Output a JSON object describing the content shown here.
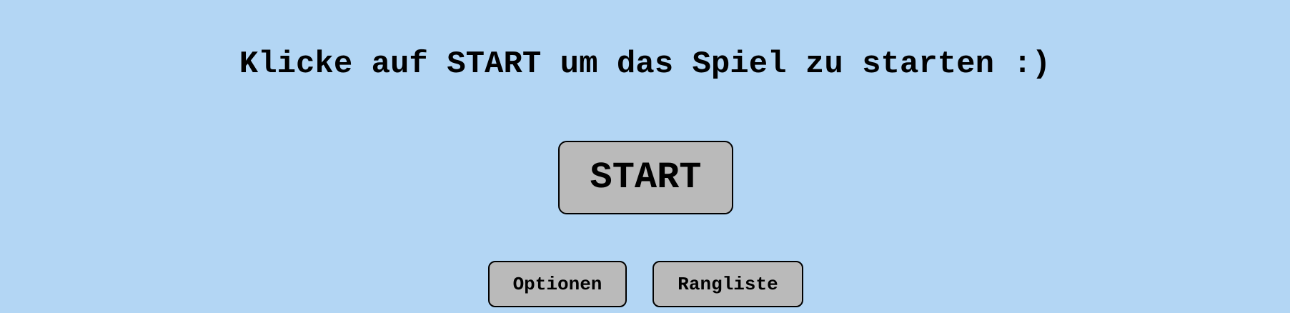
{
  "screen": {
    "title": "Klicke auf START um das Spiel zu starten :)",
    "background_color": "#b3d6f4"
  },
  "buttons": {
    "start_label": "START",
    "options_label": "Optionen",
    "ranking_label": "Rangliste",
    "button_color": "#bababa"
  }
}
